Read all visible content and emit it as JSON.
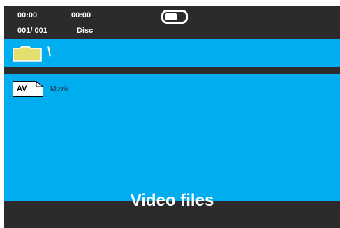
{
  "status": {
    "elapsed_time": "00:00",
    "total_time": "00:00",
    "track_counter": "001/ 001",
    "media_source": "Disc"
  },
  "icons": {
    "playback_indicator": "playback-indicator-icon",
    "folder": "folder-icon",
    "video_file": "av-file-icon"
  },
  "path_bar": {
    "current_path": "\\"
  },
  "file_list": {
    "items": [
      {
        "icon_label": "AV",
        "name": "Movie"
      }
    ]
  },
  "caption": "Video files",
  "colors": {
    "panel_blue": "#00aeef",
    "frame_dark": "#2b2b2b",
    "folder_yellow": "#e2df6e",
    "text_white": "#ffffff"
  }
}
